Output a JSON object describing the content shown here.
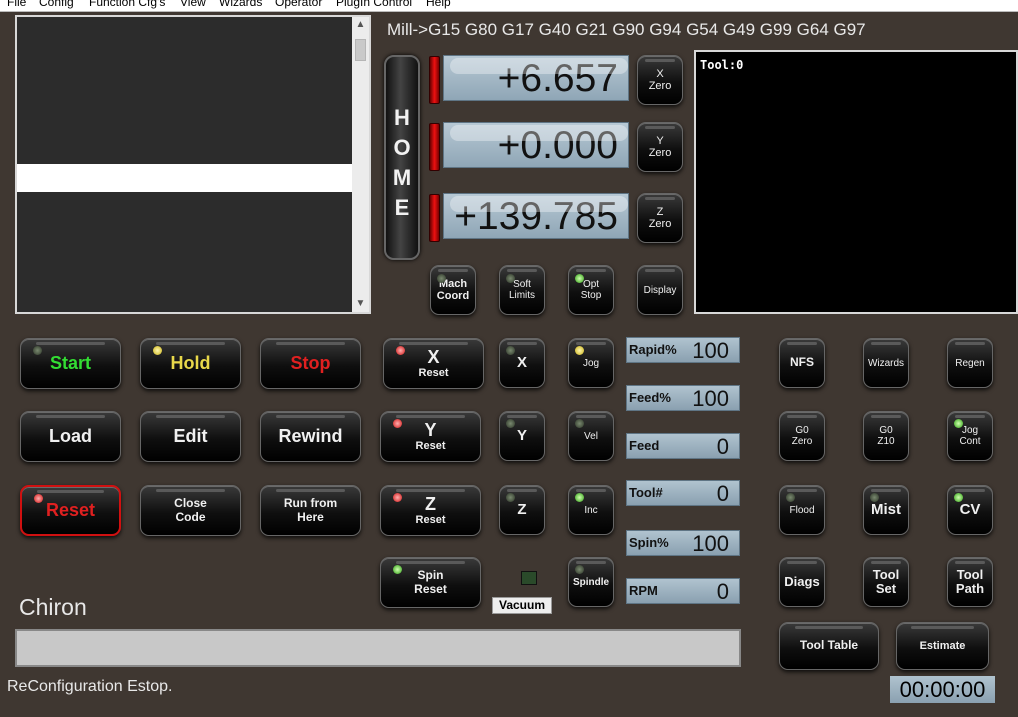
{
  "menu": [
    "File",
    "Config",
    "Function Cfg's",
    "View",
    "Wizards",
    "Operator",
    "PlugIn Control",
    "Help"
  ],
  "gcodes": "Mill->G15  G80 G17 G40 G21 G90 G94 G54 G49 G99 G64 G97",
  "home_letters": [
    "H",
    "O",
    "M",
    "E"
  ],
  "dro": {
    "x": "+6.657",
    "y": "+0.000",
    "z": "+139.785"
  },
  "zero_buttons": [
    {
      "axis": "X",
      "label": "Zero"
    },
    {
      "axis": "Y",
      "label": "Zero"
    },
    {
      "axis": "Z",
      "label": "Zero"
    }
  ],
  "toolpath_label": "Tool:0",
  "small_buttons": {
    "mach_coord": [
      "Mach",
      "Coord"
    ],
    "soft_limits": [
      "Soft",
      "Limits"
    ],
    "opt_stop": [
      "Opt",
      "Stop"
    ],
    "display": "Display"
  },
  "main_buttons": {
    "start": "Start",
    "hold": "Hold",
    "stop": "Stop",
    "load": "Load",
    "edit": "Edit",
    "rewind": "Rewind",
    "reset": "Reset",
    "close_code": [
      "Close",
      "Code"
    ],
    "run_from_here": [
      "Run from",
      "Here"
    ]
  },
  "axis_reset": [
    {
      "axis": "X",
      "label": "Reset"
    },
    {
      "axis": "Y",
      "label": "Reset"
    },
    {
      "axis": "Z",
      "label": "Reset"
    }
  ],
  "axis_select": [
    "X",
    "Y",
    "Z"
  ],
  "jog_buttons": {
    "jog": "Jog",
    "vel": "Vel",
    "inc": "Inc",
    "spindle": "Spindle"
  },
  "spin_reset": [
    "Spin",
    "Reset"
  ],
  "vacuum": "Vacuum",
  "readouts": [
    {
      "label": "Rapid%",
      "value": "100"
    },
    {
      "label": "Feed%",
      "value": "100"
    },
    {
      "label": "Feed",
      "value": "0"
    },
    {
      "label": "Tool#",
      "value": "0"
    },
    {
      "label": "Spin%",
      "value": "100"
    },
    {
      "label": "RPM",
      "value": "0"
    }
  ],
  "right_buttons": {
    "nfs": "NFS",
    "wizards": "Wizards",
    "regen": "Regen",
    "g0_zero": [
      "G0",
      "Zero"
    ],
    "g0_z10": [
      "G0",
      "Z10"
    ],
    "jog_cont": [
      "Jog",
      "Cont"
    ],
    "flood": "Flood",
    "mist": "Mist",
    "cv": "CV",
    "diags": "Diags",
    "tool_set": [
      "Tool",
      "Set"
    ],
    "tool_path": [
      "Tool",
      "Path"
    ],
    "tool_table": "Tool Table",
    "estimate": "Estimate"
  },
  "profile": "Chiron",
  "status": "ReConfiguration Estop.",
  "timer": "00:00:00",
  "colors": {
    "background": "#3f3731",
    "led_green": "#2d9f10",
    "led_red": "#d01010",
    "led_yellow": "#c8b010",
    "start_text": "#33dd33",
    "hold_text": "#e8d84a",
    "stop_text": "#e02020"
  }
}
